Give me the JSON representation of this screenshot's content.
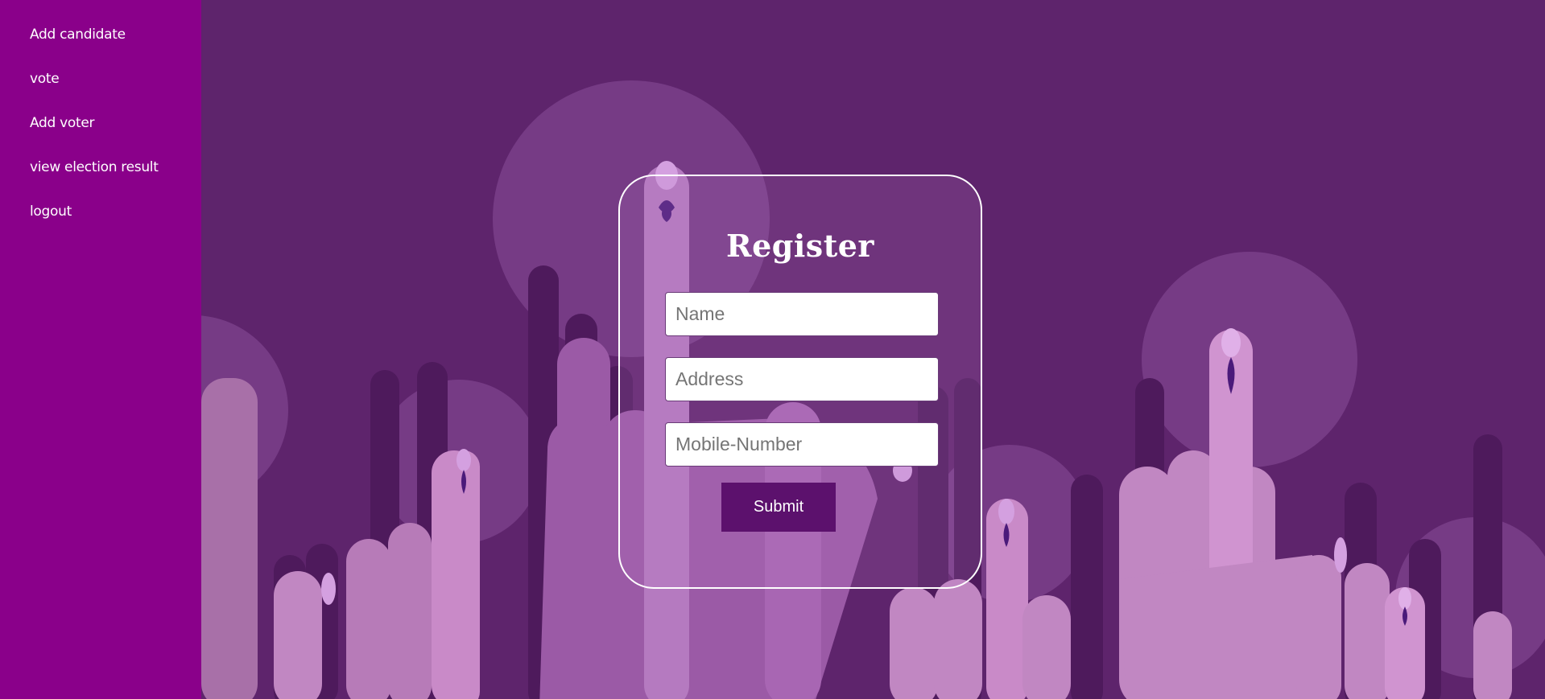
{
  "sidebar": {
    "items": [
      {
        "label": "Add candidate"
      },
      {
        "label": "vote"
      },
      {
        "label": "Add voter"
      },
      {
        "label": "view election result"
      },
      {
        "label": "logout"
      }
    ]
  },
  "form": {
    "title": "Register",
    "name_placeholder": "Name",
    "address_placeholder": "Address",
    "mobile_placeholder": "Mobile-Number",
    "submit_label": "Submit"
  },
  "colors": {
    "sidebar_bg": "#8a008a",
    "main_bg": "#5e246c",
    "submit_bg": "#5c116d"
  }
}
